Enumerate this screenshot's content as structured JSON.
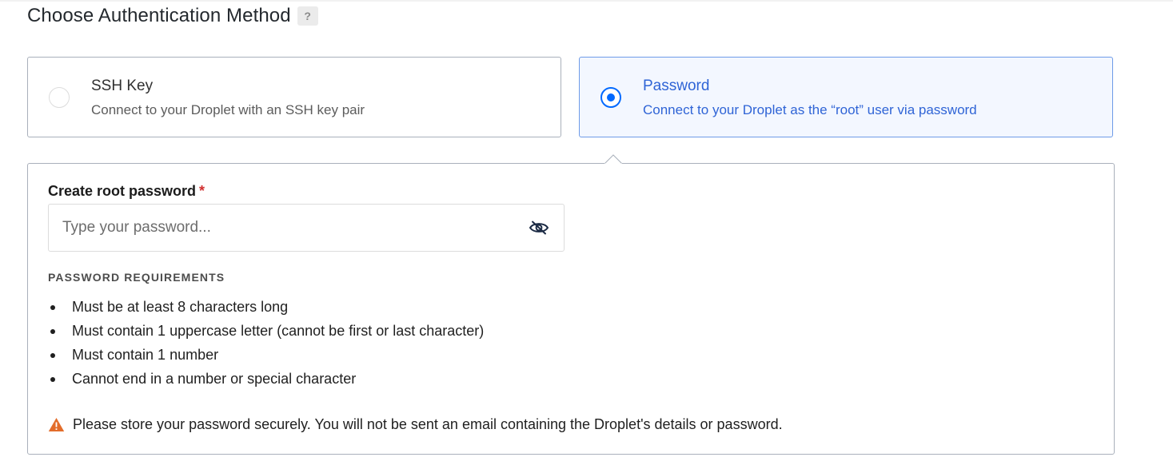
{
  "heading": {
    "title": "Choose Authentication Method",
    "help_label": "?"
  },
  "options": [
    {
      "title": "SSH Key",
      "description": "Connect to your Droplet with an SSH key pair",
      "selected": false
    },
    {
      "title": "Password",
      "description": "Connect to your Droplet as the “root” user via password",
      "selected": true
    }
  ],
  "password": {
    "label": "Create root password",
    "required_marker": "*",
    "placeholder": "Type your password...",
    "value": ""
  },
  "requirements": {
    "heading": "PASSWORD REQUIREMENTS",
    "items": [
      "Must be at least 8 characters long",
      "Must contain 1 uppercase letter (cannot be first or last character)",
      "Must contain 1 number",
      "Cannot end in a number or special character"
    ]
  },
  "warning": {
    "icon": "warning-icon",
    "text": "Please store your password securely. You will not be sent an email containing the Droplet's details or password."
  },
  "colors": {
    "accent": "#0069ff",
    "selected_text": "#2f64d6",
    "selected_bg": "#f3f7ff",
    "warning": "#e36d2b",
    "required": "#d12f2f"
  }
}
